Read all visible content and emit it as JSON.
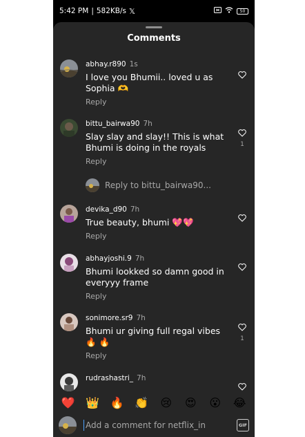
{
  "status_bar": {
    "time": "5:42 PM",
    "separator": "|",
    "speed": "582KB/s",
    "x_logo": "𝕏",
    "battery": "50"
  },
  "sheet": {
    "title": "Comments"
  },
  "comments": [
    {
      "username": "abhay.r890",
      "time": "1s",
      "text": "I love you Bhumii.. loved u as Sophia 🫶",
      "reply": "Reply",
      "likes": ""
    },
    {
      "username": "bittu_bairwa90",
      "time": "7h",
      "text": "Slay slay and slay!! This is what Bhumi is doing in the royals",
      "reply": "Reply",
      "likes": "1"
    },
    {
      "username": "devika_d90",
      "time": "7h",
      "text": "True beauty, bhumi 💖💖",
      "reply": "Reply",
      "likes": ""
    },
    {
      "username": "abhayjoshi.9",
      "time": "7h",
      "text": "Bhumi lookked so damn good in everyyy frame",
      "reply": "Reply",
      "likes": ""
    },
    {
      "username": "sonimore.sr9",
      "time": "7h",
      "text": "Bhumi ur giving full regal vibes 🔥 🔥",
      "reply": "Reply",
      "likes": "1"
    },
    {
      "username": "rudrashastri_",
      "time": "7h",
      "text": "",
      "reply": "",
      "likes": ""
    }
  ],
  "reply_thread": {
    "text": "Reply to bittu_bairwa90..."
  },
  "emoji_bar": [
    "❤️",
    "👑",
    "🔥",
    "👏",
    "😢",
    "😍",
    "😮",
    "😂"
  ],
  "composer": {
    "placeholder": "Add a comment for netflix_in",
    "gif_label": "GIF"
  },
  "colors": {
    "sheet_bg": "#262626",
    "text": "#ffffff",
    "muted": "#a8a8a8",
    "phone_bg": "#000000"
  }
}
